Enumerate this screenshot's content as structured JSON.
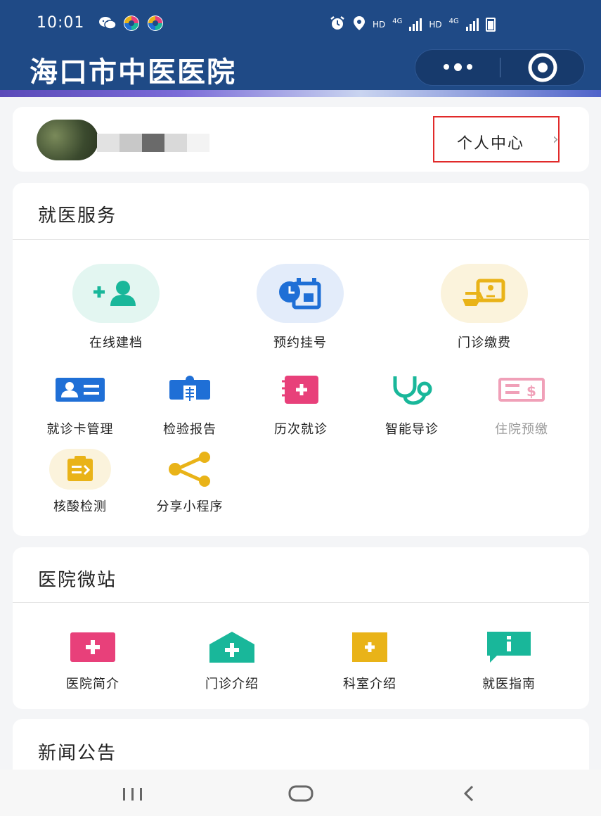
{
  "status_bar": {
    "time": "10:01",
    "hd1": "HD",
    "net1": "4G",
    "hd2": "HD",
    "net2": "4G"
  },
  "app": {
    "title": "海口市中医医院"
  },
  "profile": {
    "link_label": "个人中心"
  },
  "services": {
    "title": "就医服务",
    "items": [
      {
        "label": "在线建档",
        "icon": "add-user-icon",
        "color": "#19b79a"
      },
      {
        "label": "预约挂号",
        "icon": "calendar-clock-icon",
        "color": "#1f6fd6"
      },
      {
        "label": "门诊缴费",
        "icon": "payment-card-icon",
        "color": "#e9b318"
      },
      {
        "label": "就诊卡管理",
        "icon": "id-card-icon",
        "color": "#1f6fd6"
      },
      {
        "label": "检验报告",
        "icon": "xray-report-icon",
        "color": "#1f6fd6"
      },
      {
        "label": "历次就诊",
        "icon": "medical-record-icon",
        "color": "#e8407a"
      },
      {
        "label": "智能导诊",
        "icon": "stethoscope-icon",
        "color": "#19b79a"
      },
      {
        "label": "住院预缴",
        "icon": "prepay-voucher-icon",
        "color": "#f0a0b8"
      },
      {
        "label": "核酸检测",
        "icon": "clipboard-test-icon",
        "color": "#e9b318"
      },
      {
        "label": "分享小程序",
        "icon": "share-icon",
        "color": "#e9b318"
      }
    ]
  },
  "microsite": {
    "title": "医院微站",
    "items": [
      {
        "label": "医院简介",
        "icon": "hospital-plus-icon",
        "color": "#e8407a"
      },
      {
        "label": "门诊介绍",
        "icon": "clinic-house-icon",
        "color": "#19b79a"
      },
      {
        "label": "科室介绍",
        "icon": "department-plus-icon",
        "color": "#e9b318"
      },
      {
        "label": "就医指南",
        "icon": "guide-info-icon",
        "color": "#19b79a"
      }
    ]
  },
  "news": {
    "title": "新闻公告"
  }
}
